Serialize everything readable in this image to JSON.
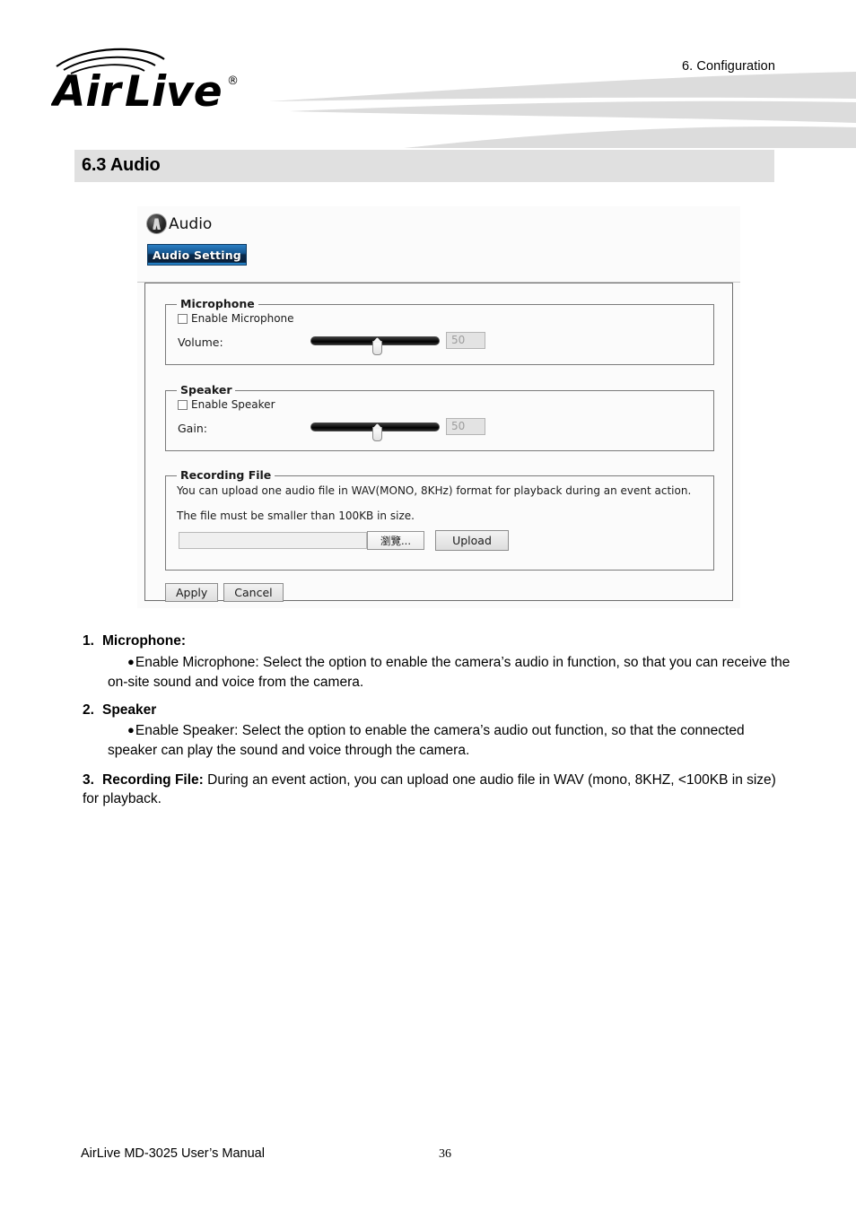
{
  "header": {
    "chapter": "6.  Configuration",
    "logo_text": "AirLive",
    "logo_registered": "®"
  },
  "section": {
    "title": "6.3 Audio"
  },
  "screenshot": {
    "panel_title": "Audio",
    "panel_icon": "audio-person-icon",
    "tab_label": "Audio Setting",
    "microphone": {
      "legend": "Microphone",
      "checkbox_label": "Enable Microphone",
      "checkbox_checked": false,
      "slider_label": "Volume:",
      "slider_value": "50"
    },
    "speaker": {
      "legend": "Speaker",
      "checkbox_label": "Enable Speaker",
      "checkbox_checked": false,
      "slider_label": "Gain:",
      "slider_value": "50"
    },
    "recording": {
      "legend": "Recording File",
      "line1": "You can upload one audio file in WAV(MONO, 8KHz) format for playback during an event action.",
      "line2": "The file must be smaller than 100KB in size.",
      "file_path_value": "",
      "browse_label": "瀏覽...",
      "upload_label": "Upload"
    },
    "actions": {
      "apply_label": "Apply",
      "cancel_label": "Cancel"
    }
  },
  "body": {
    "item1": {
      "number": "1.",
      "heading": "Microphone:",
      "bullet": "Enable Microphone: Select the option to enable the camera’s audio in function, so that you can receive the on-site sound and voice from the camera."
    },
    "item2": {
      "number": "2.",
      "heading": "Speaker",
      "bullet": "Enable Speaker: Select the option to enable the camera’s audio out function, so that the connected speaker can play the sound and voice through the camera."
    },
    "item3": {
      "number": "3.",
      "bold_lead": "Recording File:",
      "text": " During an event action, you can upload one audio file in WAV (mono, 8KHZ, <100KB in size) for playback."
    }
  },
  "footer": {
    "manual": "AirLive MD-3025 User’s Manual",
    "page": "36"
  }
}
